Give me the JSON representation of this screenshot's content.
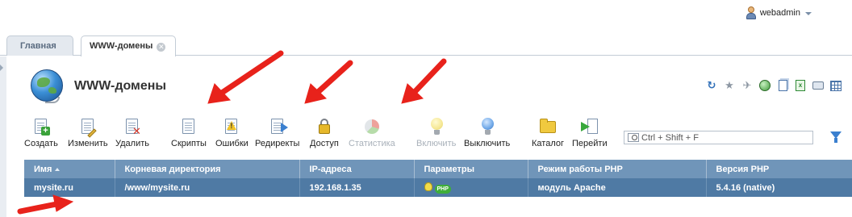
{
  "header": {
    "username": "webadmin"
  },
  "tabs": [
    {
      "label": "Главная"
    },
    {
      "label": "WWW-домены"
    }
  ],
  "page": {
    "title": "WWW-домены"
  },
  "toolbar": {
    "create": "Создать",
    "edit": "Изменить",
    "delete": "Удалить",
    "scripts": "Скрипты",
    "errors": "Ошибки",
    "redirects": "Редиректы",
    "access": "Доступ",
    "statistics": "Статистика",
    "enable": "Включить",
    "disable": "Выключить",
    "catalog": "Каталог",
    "goto": "Перейти"
  },
  "search": {
    "placeholder": "Ctrl + Shift + F"
  },
  "table": {
    "headers": [
      "Имя",
      "Корневая директория",
      "IP-адреса",
      "Параметры",
      "Режим работы PHP",
      "Версия PHP"
    ],
    "rows": [
      {
        "name": "mysite.ru",
        "root": "/www/mysite.ru",
        "ip": "192.168.1.35",
        "php_mode": "модуль Apache",
        "php_version": "5.4.16 (native)"
      }
    ]
  },
  "colors": {
    "header_bg": "#7095b9",
    "selected_row_bg": "#4f7aa4",
    "annotation_arrow": "#e8221b"
  },
  "icons": [
    "user-icon",
    "refresh-icon",
    "star-icon",
    "pin-icon",
    "globe-icon",
    "copy-icon",
    "excel-icon",
    "print-icon",
    "table-settings-icon",
    "filter-icon"
  ]
}
